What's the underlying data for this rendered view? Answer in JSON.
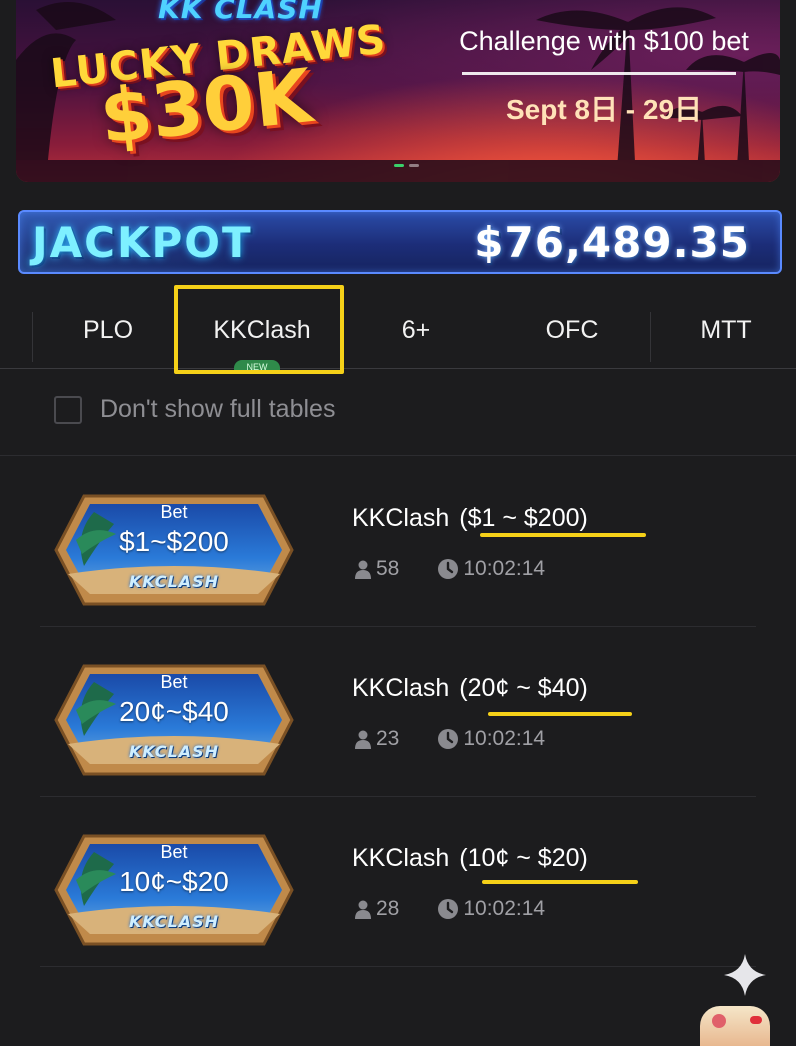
{
  "banner": {
    "brand": "KK CLASH",
    "title": "LUCKY DRAWS",
    "amount": "$30K",
    "challenge": "Challenge with $100 bet",
    "date": "Sept 8日 - 29日",
    "page_count": 2,
    "active_page": 1
  },
  "jackpot": {
    "label": "JACKPOT",
    "amount": "$76,489.35"
  },
  "tabs": [
    {
      "label": "PLO",
      "selected": false
    },
    {
      "label": "KKClash",
      "selected": true,
      "badge": "NEW"
    },
    {
      "label": "6+",
      "selected": false
    },
    {
      "label": "OFC",
      "selected": false
    },
    {
      "label": "MTT",
      "selected": false
    }
  ],
  "filter": {
    "label": "Don't show full tables",
    "checked": false
  },
  "games": [
    {
      "badge_bet": "Bet",
      "badge_range": "$1~$200",
      "badge_brand": "KKCLASH",
      "name": "KKClash",
      "stakes": "($1 ~ $200)",
      "players": "58",
      "time": "10:02:14"
    },
    {
      "badge_bet": "Bet",
      "badge_range": "20¢~$40",
      "badge_brand": "KKCLASH",
      "name": "KKClash",
      "stakes": "(20¢ ~ $40)",
      "players": "23",
      "time": "10:02:14"
    },
    {
      "badge_bet": "Bet",
      "badge_range": "10¢~$20",
      "badge_brand": "KKCLASH",
      "name": "KKClash",
      "stakes": "(10¢ ~ $20)",
      "players": "28",
      "time": "10:02:14"
    }
  ],
  "colors": {
    "background": "#1c1c1e",
    "highlight": "#f5d018",
    "jackpot_blue": "#1c2d78",
    "muted_text": "#8e8e93"
  },
  "icons": [
    "player-icon",
    "clock-icon",
    "sparkle-icon",
    "checkbox-icon"
  ]
}
